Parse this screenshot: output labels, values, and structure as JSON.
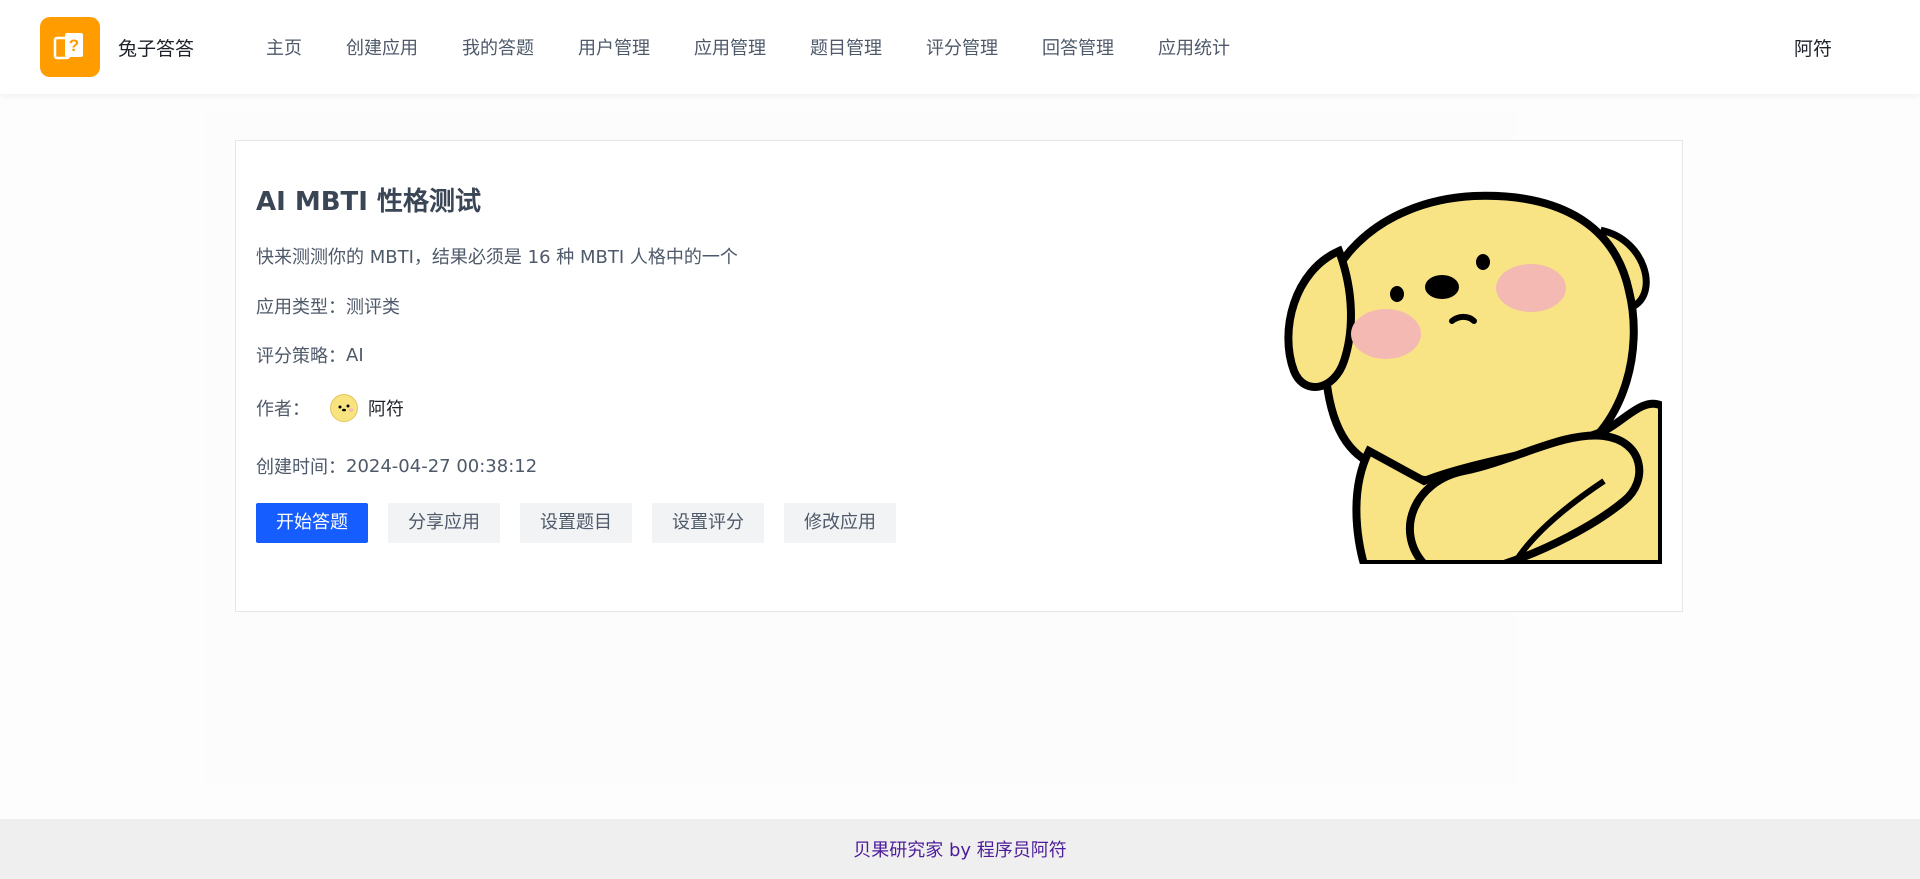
{
  "header": {
    "brand": "兔子答答",
    "nav": [
      "主页",
      "创建应用",
      "我的答题",
      "用户管理",
      "应用管理",
      "题目管理",
      "评分管理",
      "回答管理",
      "应用统计"
    ],
    "user": "阿符",
    "logo_color": "#ff9c00"
  },
  "app": {
    "title": "AI MBTI 性格测试",
    "description": "快来测测你的 MBTI，结果必须是 16 种 MBTI 人格中的一个",
    "type_label": "应用类型：",
    "type_value": "测评类",
    "strategy_label": "评分策略：",
    "strategy_value": "AI",
    "author_label": "作者：",
    "author_name": "阿符",
    "created_label": "创建时间：",
    "created_value": "2024-04-27 00:38:12",
    "illustration": "yellow-dog-illustration"
  },
  "actions": {
    "start": "开始答题",
    "share": "分享应用",
    "set_questions": "设置题目",
    "set_scoring": "设置评分",
    "edit": "修改应用"
  },
  "footer": {
    "text": "贝果研究家 by 程序员阿符"
  },
  "colors": {
    "primary": "#165dff",
    "footer_link": "#4d1c9b"
  }
}
